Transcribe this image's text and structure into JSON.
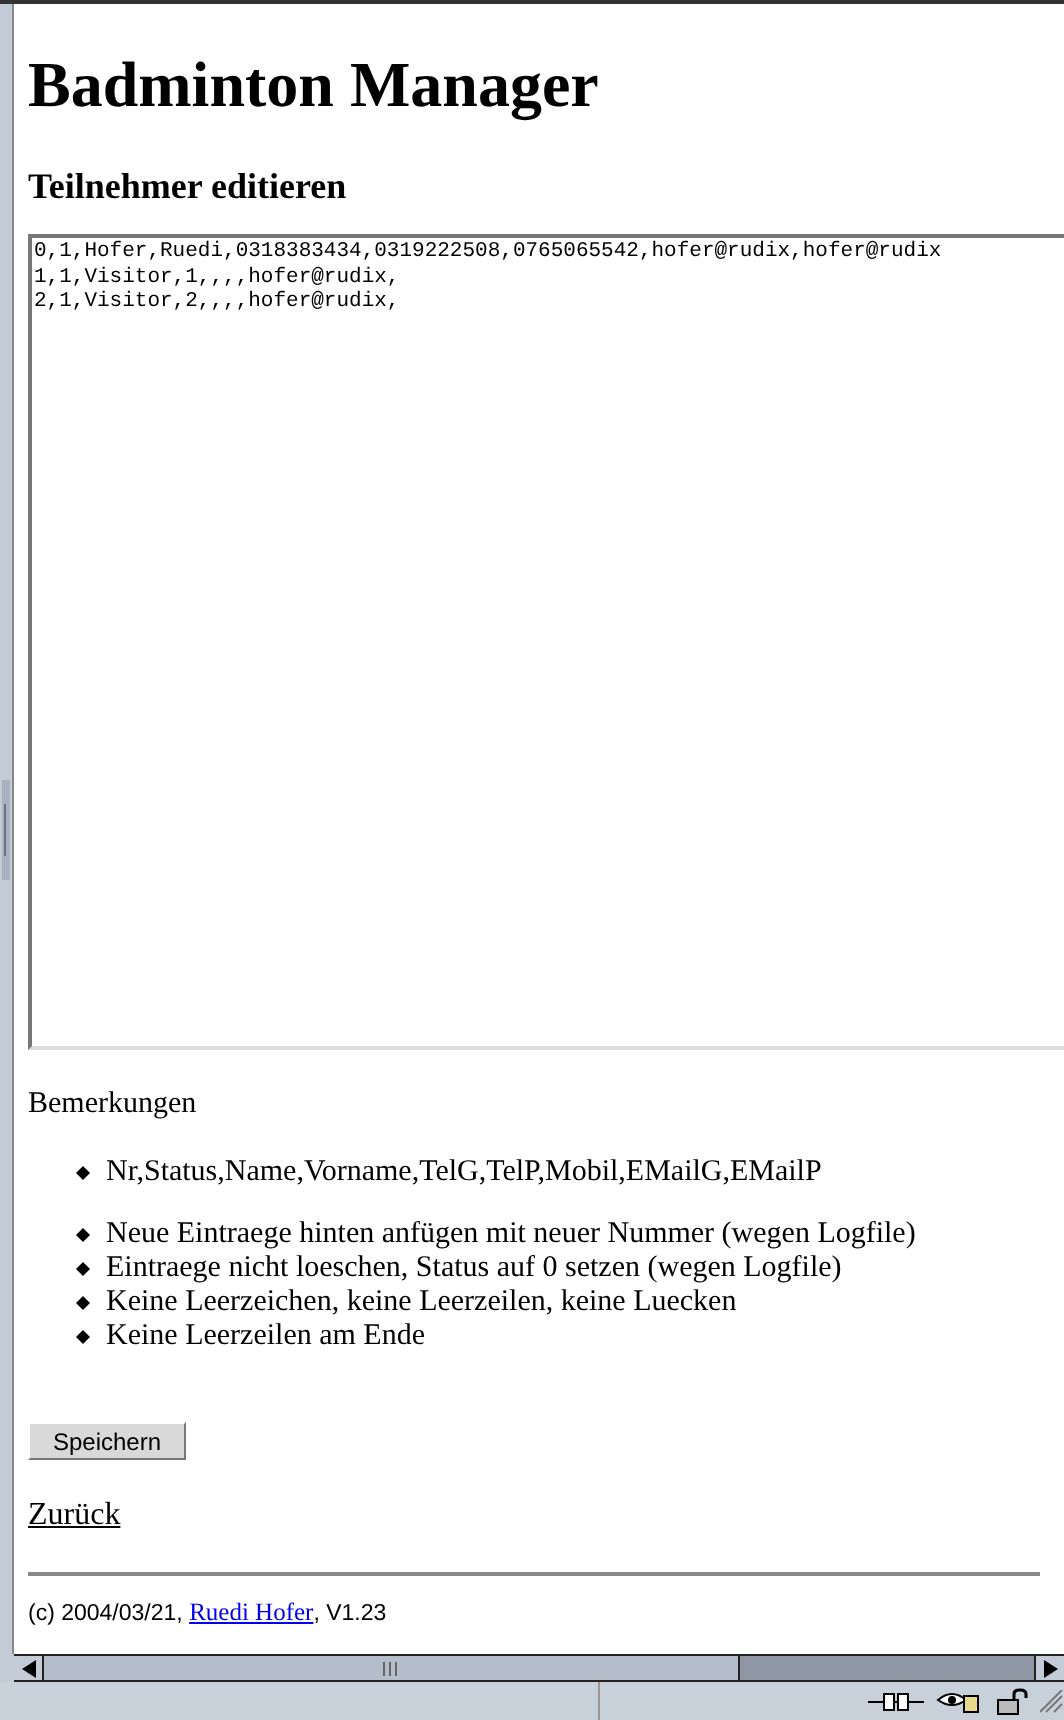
{
  "title": "Badminton Manager",
  "subtitle": "Teilnehmer editieren",
  "editor": {
    "lines": [
      "0,1,Hofer,Ruedi,0318383434,0319222508,0765065542,hofer@rudix,hofer@rudix",
      "1,1,Visitor,1,,,,hofer@rudix,",
      "2,1,Visitor,2,,,,hofer@rudix,"
    ]
  },
  "remarks": {
    "heading": "Bemerkungen",
    "groups": [
      [
        "Nr,Status,Name,Vorname,TelG,TelP,Mobil,EMailG,EMailP"
      ],
      [
        "Neue Eintraege hinten anfügen mit neuer Nummer (wegen Logfile)",
        "Eintraege nicht loeschen, Status auf 0 setzen (wegen Logfile)",
        "Keine Leerzeichen, keine Leerzeilen, keine Luecken",
        "Keine Leerzeilen am Ende"
      ]
    ]
  },
  "save_button": "Speichern",
  "back_link": "Zurück",
  "footer": {
    "before": "(c) 2004/03/21, ",
    "link": "Ruedi Hofer",
    "after": ", V1.23"
  }
}
